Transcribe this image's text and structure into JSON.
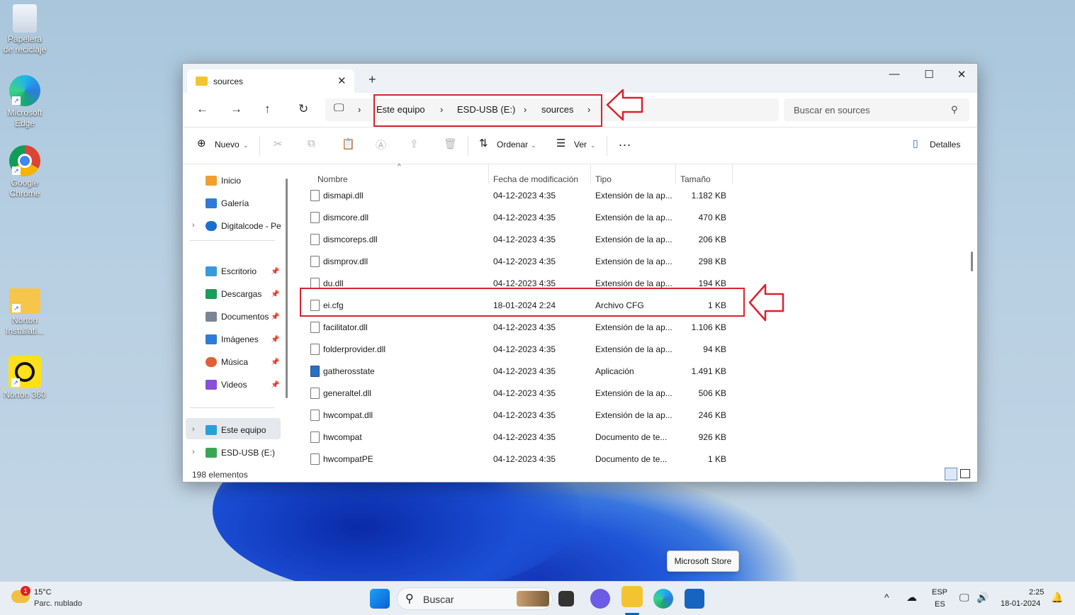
{
  "desktop": {
    "icons": [
      {
        "label": "Papelera de reciclaje",
        "icon": "recycle-bin-icon"
      },
      {
        "label": "Microsoft Edge",
        "icon": "edge-icon"
      },
      {
        "label": "Google Chrome",
        "icon": "chrome-icon"
      },
      {
        "label": "Norton Installati...",
        "icon": "folder-icon"
      },
      {
        "label": "Norton 360",
        "icon": "norton-icon"
      }
    ]
  },
  "window": {
    "tab_title": "sources",
    "breadcrumb": [
      "Este equipo",
      "ESD-USB (E:)",
      "sources"
    ],
    "search_placeholder": "Buscar en sources",
    "toolbar": {
      "new": "Nuevo",
      "sort": "Ordenar",
      "view": "Ver",
      "more": "...",
      "details": "Detalles"
    },
    "sidebar": {
      "quick": [
        {
          "label": "Inicio",
          "color": "#f0a030"
        },
        {
          "label": "Galería",
          "color": "#2f7bd6"
        },
        {
          "label": "Digitalcode - Pe",
          "color": "#1a6fd0"
        }
      ],
      "pinned": [
        {
          "label": "Escritorio",
          "color": "#3a9ad9"
        },
        {
          "label": "Descargas",
          "color": "#1f9a5a"
        },
        {
          "label": "Documentos",
          "color": "#7a8694"
        },
        {
          "label": "Imágenes",
          "color": "#2f7bd6"
        },
        {
          "label": "Música",
          "color": "#e0603a"
        },
        {
          "label": "Videos",
          "color": "#8a4fd6"
        }
      ],
      "drives": [
        {
          "label": "Este equipo",
          "color": "#2aa0d8"
        },
        {
          "label": "ESD-USB (E:)",
          "color": "#3aa655"
        }
      ]
    },
    "columns": [
      "Nombre",
      "Fecha de modificación",
      "Tipo",
      "Tamaño"
    ],
    "files": [
      {
        "name": "dismapi.dll",
        "date": "04-12-2023 4:35",
        "type": "Extensión de la ap...",
        "size": "1.182 KB"
      },
      {
        "name": "dismcore.dll",
        "date": "04-12-2023 4:35",
        "type": "Extensión de la ap...",
        "size": "470 KB"
      },
      {
        "name": "dismcoreps.dll",
        "date": "04-12-2023 4:35",
        "type": "Extensión de la ap...",
        "size": "206 KB"
      },
      {
        "name": "dismprov.dll",
        "date": "04-12-2023 4:35",
        "type": "Extensión de la ap...",
        "size": "298 KB"
      },
      {
        "name": "du.dll",
        "date": "04-12-2023 4:35",
        "type": "Extensión de la ap...",
        "size": "194 KB"
      },
      {
        "name": "ei.cfg",
        "date": "18-01-2024 2:24",
        "type": "Archivo CFG",
        "size": "1 KB"
      },
      {
        "name": "facilitator.dll",
        "date": "04-12-2023 4:35",
        "type": "Extensión de la ap...",
        "size": "1.106 KB"
      },
      {
        "name": "folderprovider.dll",
        "date": "04-12-2023 4:35",
        "type": "Extensión de la ap...",
        "size": "94 KB"
      },
      {
        "name": "gatherosstate",
        "date": "04-12-2023 4:35",
        "type": "Aplicación",
        "size": "1.491 KB"
      },
      {
        "name": "generaltel.dll",
        "date": "04-12-2023 4:35",
        "type": "Extensión de la ap...",
        "size": "506 KB"
      },
      {
        "name": "hwcompat.dll",
        "date": "04-12-2023 4:35",
        "type": "Extensión de la ap...",
        "size": "246 KB"
      },
      {
        "name": "hwcompat",
        "date": "04-12-2023 4:35",
        "type": "Documento de te...",
        "size": "926 KB"
      },
      {
        "name": "hwcompatPE",
        "date": "04-12-2023 4:35",
        "type": "Documento de te...",
        "size": "1 KB"
      }
    ],
    "status": "198 elementos"
  },
  "tooltip": "Microsoft Store",
  "taskbar": {
    "weather_temp": "15°C",
    "weather_desc": "Parc. nublado",
    "weather_badge": "1",
    "search_label": "Buscar",
    "lang1": "ESP",
    "lang2": "ES",
    "time": "2:25",
    "date": "18-01-2024"
  },
  "colors": {
    "accent": "#0067c0",
    "highlight": "#d9232d"
  }
}
